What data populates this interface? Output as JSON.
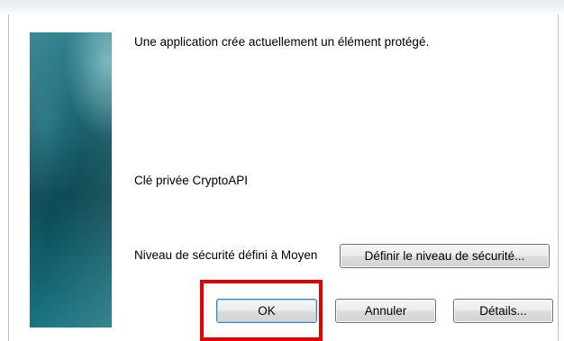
{
  "dialog": {
    "message": "Une application crée actuellement un élément protégé.",
    "key_label": "Clé privée CryptoAPI",
    "security_level_text": "Niveau de sécurité défini à Moyen"
  },
  "buttons": {
    "set_level": "Définir le niveau de sécurité...",
    "ok": "OK",
    "cancel": "Annuler",
    "details": "Détails..."
  },
  "colors": {
    "highlight": "#e60000",
    "banner": "#0e4f5a"
  }
}
